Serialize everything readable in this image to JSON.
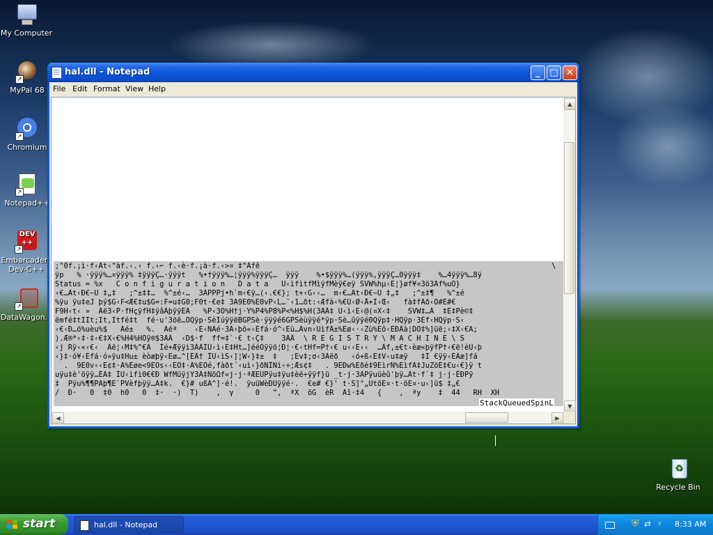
{
  "desktop": {
    "icons": [
      {
        "label": "My Computer",
        "icon": "my-computer-icon"
      },
      {
        "label": "MyPal 68",
        "icon": "mypal-browser-icon"
      },
      {
        "label": "Chromium",
        "icon": "chromium-icon"
      },
      {
        "label": "Notepad++",
        "icon": "notepad-plus-plus-icon"
      },
      {
        "label": "Embarcadero Dev-C++",
        "line1": "Embarcadero",
        "line2": "Dev-C++",
        "icon": "dev-cpp-icon"
      },
      {
        "label": "DataWagon...",
        "icon": "datawagon-icon"
      },
      {
        "label": "Recycle Bin",
        "icon": "recycle-bin-icon"
      }
    ]
  },
  "window": {
    "title": "hal.dll - Notepad",
    "controls": {
      "minimize": "_",
      "maximize": "□",
      "close": "✕"
    },
    "menu": [
      "File",
      "Edit",
      "Format",
      "View",
      "Help"
    ],
    "text_lines": [
      ";\"0f.¡ì·f‹Àt‹\"àf.‹.‹ f.‹⌐ f.‹è·f.¡à·f.‹>¤ ‡\"Àfê                                                                   \\",
      "ÿp   % ·ÿÿÿ%…¤ÿÿÿ% ‡ÿÿÿÇ…·ÿÿÿt   %•†ÿÿÿ%…¦ÿÿÿ%ÿÿÿÇ…  ÿÿÿ    %•$ÿÿÿ%…(ÿÿÿ%,ÿÿÿÇ…0ÿÿÿ‡    %…4ÿÿÿ%…8ÿ",
      "Status = %x   C o n f i g u r a t i o n   D a t a   U‹ìfìtfMìÿfMèÿ€eÿ SVW%hµ‹E¦}øf¥¤3ö3Àf%uÖ}",
      "‹€…Àt‹Ð€~U ‡„‡   ;^±‡‡…  %^±é‹…  3ÀPPPj•h`m‹€ÿ…(‹.€€}; t+‹G‹‹…  m‹€…Àt‹Ð€~U ‡„‡   ;^±‡¶   %^±é",
      "%ÿu ÿu‡eJ þý$G‹F<Æ€‡u$G=:F=u‡G0;F0t·€e‡ 3À9E0%E0vP‹L…¨‹1…ðt:‹Æfà‹%€Ù‹Ø‹Å+Ì‹Œ‹   fà‡fÀð‹Ö#È#€",
      "F9H‹t‹ »  Àë3‹P·fHçÿfH‡ÿâÀþÿÿÉÀ   %P‹3Ö%H†j·Y%P4%P8%P<%H$%H(3ÀÂ‡ U‹ì‹E‹@(¤X‹‡    SVW‡…À  ‡E‡Pè©‡",
      "ëmfé‡tIIt;It,Itfé‡t  fé·u'3öë…ÖQÿp·SèÍúÿÿëBGPSè·ÿÿÿé6GPSèùÿÿé*ÿp·Sè…ûÿÿé0Qÿp‡·HQÿp·3Éf‹HQÿp·S‹",
      "‹€‹Ð…ö%uèu%$   Àé±   %.  Àéª    ‹E‹ÑÁé·3À‹þö«‹Éfá·ó^‹Eù…Àvn‹UìfÂ±%Eø‹·‹Zù%Eô‹ÈÐÂà¦DÖ‡%]üë;‹‡X‹€A;",
      ").Æ®*‹‡·‡‹€‡X‹€%H4%HÖÿ®$3ÀÂ  ‹D$·f  ff=‡`·€ t‹Ç‡    3ÀÂ  \\ R E G I S T R Y \\ M A C H I N E \\ S",
      "‹j Rÿ‹«‹€‹  Àë¦‹M‡%^€À  Ìé+Æÿÿì3ÀÀÌU‹ì‹E‡Ht…]ééÒÿÿö¦Ð¦·€‹tHf=P†‹€ u‹‹E‹‹  …Àf,±€t‹èæ«þÿfP†‹€ë!èÙ‹þ",
      "‹}‡·ó¥‹Éfá·ó»ÿu‡Hu± èòæþÿ‹Eø…^[ÉÂ† ÎU‹ìS‹]¦W‹}‡±  ‡   ;Ev‡;σ‹3Àëð   ‹ó+ß‹E‡V‹u‡æÿ   ‡Ì €ÿÿ‹ÉÀæ]fá",
      "  .  9E0v‹‹E¢‡·À%Eøe<9EÖs‹‹EÖ‡·À%EÖé,fàðt´‹uì‹}ðÑÎÑì‹÷;Æs¢‡   . 9EÐw%Eðé‡9EìrÑ%EìfÁ‡JuZöE‡€u‹€}ÿ t",
      "uÿu‡è'öÿÿ…ÉÄ‡ ÎU‹ìfì0€€Ð WfMüÿjY3À‡ÑöΩf«j·j·ªÆEÜPÿu‡ÿu‡èé÷ÿÿf}ü _t·j·3ÀPÿuüèû'þÿ…Àt·f`‡ j·j·ÊÐPÿ",
      "‡  Pÿu%¶¶PÁþ¶E`PVèfþÿÿ…À‡k.  €}# ußÀ^]·é!.  ÿuüWèÐÙÿÿé·.  €e# €}' t·Š]°„ÛtöE¤·t·öE¤·u‹]ü$ ‡„€",
      "/  Ð·   0  ‡0  h0   0  ‡·  ·)  T)    ‚  γ     0   \",  ªX  öG  èR  Àî·‡4   {    ,  ªy    ‡  44   RH  XH"
    ],
    "last_fragment": "StackQueuedSpinL"
  },
  "taskbar": {
    "start_label": "start",
    "task_button": "hal.dll - Notepad",
    "clock": "8:33 AM",
    "tray_icons": [
      "keyboard-icon",
      "security-shield-icon",
      "network-icon",
      "safely-remove-icon"
    ]
  }
}
